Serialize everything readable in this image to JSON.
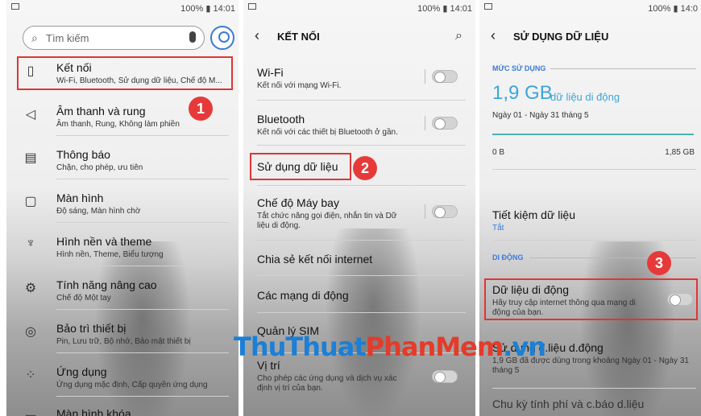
{
  "status": {
    "text_p1": "100% ▮ 14:01",
    "text_p2": "100% ▮ 14:01",
    "text_p3": "100% ▮ 14:0",
    "signal_glyph": "▣ .ıl"
  },
  "panel1": {
    "search_placeholder": "Tìm kiếm",
    "items": [
      {
        "title": "Kết nối",
        "subtitle": "Wi-Fi, Bluetooth, Sử dụng dữ liệu, Chế độ M...",
        "icon": "connections-icon"
      },
      {
        "title": "Âm thanh và rung",
        "subtitle": "Âm thanh, Rung, Không làm phiền",
        "icon": "sound-icon"
      },
      {
        "title": "Thông báo",
        "subtitle": "Chặn, cho phép, ưu tiên",
        "icon": "notification-icon"
      },
      {
        "title": "Màn hình",
        "subtitle": "Độ sáng, Màn hình chờ",
        "icon": "display-icon"
      },
      {
        "title": "Hình nền và theme",
        "subtitle": "Hình nền, Theme, Biểu tượng",
        "icon": "wallpaper-icon"
      },
      {
        "title": "Tính năng nâng cao",
        "subtitle": "Chế độ Một tay",
        "icon": "advanced-icon"
      },
      {
        "title": "Bảo trì thiết bị",
        "subtitle": "Pin, Lưu trữ, Bộ nhớ, Bảo mật thiết bị",
        "icon": "maintenance-icon"
      },
      {
        "title": "Ứng dụng",
        "subtitle": "Ứng dụng mặc định, Cấp quyền ứng dụng",
        "icon": "apps-icon"
      },
      {
        "title": "Màn hình khóa",
        "subtitle": "",
        "icon": "lock-screen-icon"
      }
    ],
    "step": "1"
  },
  "panel2": {
    "title": "KẾT NỐI",
    "items": [
      {
        "title": "Wi-Fi",
        "subtitle": "Kết nối với mạng Wi-Fi."
      },
      {
        "title": "Bluetooth",
        "subtitle": "Kết nối với các thiết bị Bluetooth ở gần."
      },
      {
        "title": "Sử dụng dữ liệu",
        "subtitle": ""
      },
      {
        "title": "Chế độ Máy bay",
        "subtitle": "Tắt chức năng gọi điện, nhắn tin và Dữ",
        "subtitle2": "liệu di động."
      },
      {
        "title": "Chia sẻ kết nối internet",
        "subtitle": ""
      },
      {
        "title": "Các mạng di động",
        "subtitle": ""
      },
      {
        "title": "Quản lý SIM",
        "subtitle": ""
      },
      {
        "title": "Vị trí",
        "subtitle": "Cho phép các ứng dụng và dịch vụ xác",
        "subtitle2": "định vị trí của bạn."
      }
    ],
    "step": "2"
  },
  "panel3": {
    "title": "SỬ DỤNG DỮ LIỆU",
    "usage_header": "MỨC SỬ DỤNG",
    "usage_value": "1,9 GB",
    "usage_unit": "dữ liệu di động",
    "period": "Ngày 01 - Ngày 31 tháng 5",
    "range_min": "0 B",
    "range_max": "1,85 GB",
    "saver_title": "Tiết kiệm dữ liệu",
    "saver_status": "Tắt",
    "mobile_header": "DI ĐỘNG",
    "mobile_data_title": "Dữ liệu di động",
    "mobile_data_sub1": "Hãy truy cập internet thông qua mạng di",
    "mobile_data_sub2": "động của bạn.",
    "usage_item_title": "Sử dụng d.liệu d.động",
    "usage_item_sub1": "1,9 GB đã được dùng trong khoảng Ngày 01 - Ngày 31",
    "usage_item_sub2": "tháng 5",
    "billing_title": "Chu kỳ tính phí và c.báo d.liệu",
    "step": "3"
  },
  "watermark": {
    "part1": "ThuThuat",
    "part2": "PhanMem",
    "part3": ".vn"
  }
}
